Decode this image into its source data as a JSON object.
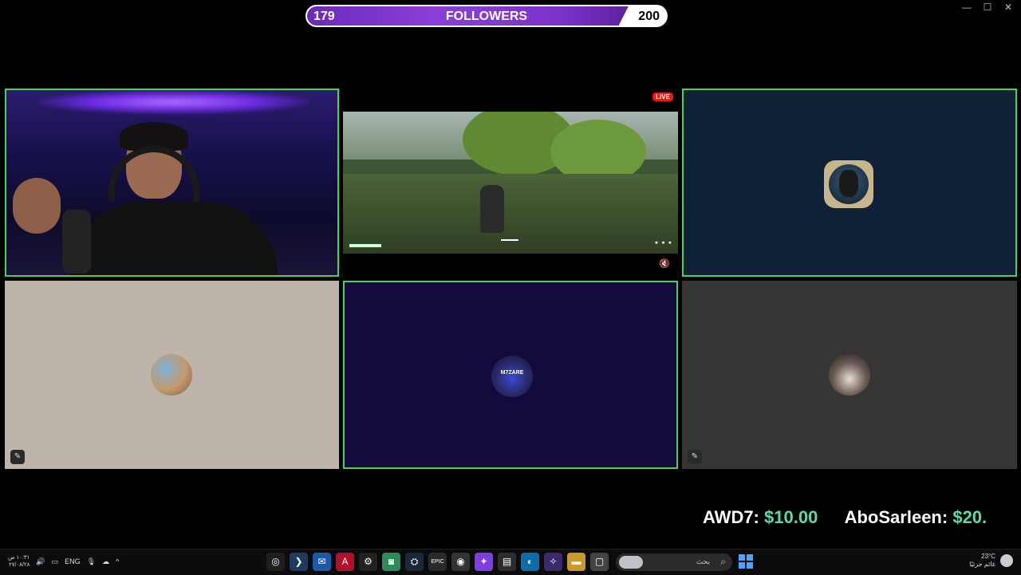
{
  "window": {
    "minimize": "—",
    "maximize": "☐",
    "close": "✕"
  },
  "goal": {
    "current": "179",
    "label": "FOLLOWERS",
    "target": "200",
    "progress": 0.895
  },
  "stream": {
    "live_label": "LIVE",
    "mute_icon": "speaker-muted-icon"
  },
  "tiles": [
    {
      "id": "webcam",
      "active": true
    },
    {
      "id": "game-stream",
      "active": false
    },
    {
      "id": "participant-1",
      "active": true
    },
    {
      "id": "participant-2",
      "active": false,
      "muted": true
    },
    {
      "id": "participant-3",
      "active": true,
      "avatar_text": "M7ZARE"
    },
    {
      "id": "participant-4",
      "active": false,
      "muted": true
    }
  ],
  "donations": [
    {
      "name": "AWD7:",
      "amount": "$10.00"
    },
    {
      "name": "AboSarleen:",
      "amount": "$20."
    }
  ],
  "taskbar": {
    "time": "١٠:٣١ ص",
    "date": "٢٧/٠٨/٢٨",
    "lang": "ENG",
    "search_placeholder": "بحث",
    "temperature": "23°C",
    "weather_desc": "غائم جزئيًا",
    "apps": [
      "search-app",
      "vscode",
      "outlook",
      "adobe",
      "steelseries",
      "discord",
      "steam",
      "epic",
      "chrome",
      "messenger",
      "store",
      "edge",
      "copilot",
      "explorer",
      "app-window"
    ]
  }
}
